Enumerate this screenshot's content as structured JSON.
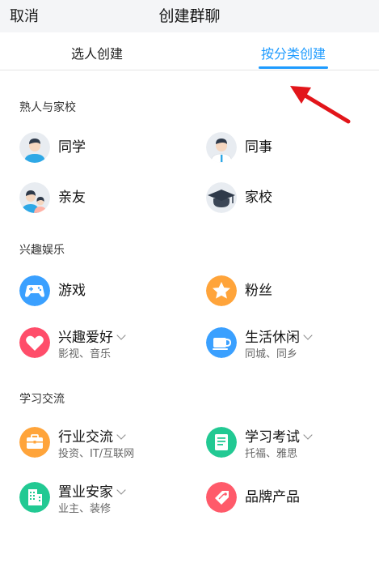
{
  "header": {
    "cancel_label": "取消",
    "title": "创建群聊"
  },
  "tabs": [
    {
      "label": "选人创建",
      "active": false
    },
    {
      "label": "按分类创建",
      "active": true
    }
  ],
  "sections": [
    {
      "title": "熟人与家校",
      "items": [
        {
          "label": "同学",
          "icon": "student-avatar-icon"
        },
        {
          "label": "同事",
          "icon": "colleague-avatar-icon"
        },
        {
          "label": "亲友",
          "icon": "family-avatar-icon"
        },
        {
          "label": "家校",
          "icon": "graduation-cap-icon"
        }
      ]
    },
    {
      "title": "兴趣娱乐",
      "items": [
        {
          "label": "游戏",
          "icon": "gamepad-icon",
          "color": "#3aa0ff"
        },
        {
          "label": "粉丝",
          "icon": "star-icon",
          "color": "#ffa43a"
        },
        {
          "label": "兴趣爱好",
          "sub": "影视、音乐",
          "icon": "heart-icon",
          "color": "#ff4d6a"
        },
        {
          "label": "生活休闲",
          "sub": "同城、同乡",
          "icon": "coffee-icon",
          "color": "#3aa0ff"
        }
      ]
    },
    {
      "title": "学习交流",
      "items": [
        {
          "label": "行业交流",
          "sub": "投资、IT/互联网",
          "icon": "briefcase-icon",
          "color": "#ffa43a"
        },
        {
          "label": "学习考试",
          "sub": "托福、雅思",
          "icon": "document-icon",
          "color": "#22c993"
        },
        {
          "label": "置业安家",
          "sub": "业主、装修",
          "icon": "building-icon",
          "color": "#22c993"
        },
        {
          "label": "品牌产品",
          "icon": "tag-icon",
          "color": "#ff5a6a"
        }
      ]
    }
  ],
  "colors": {
    "accent": "#1e9bff",
    "annotation_arrow": "#e2151a"
  }
}
